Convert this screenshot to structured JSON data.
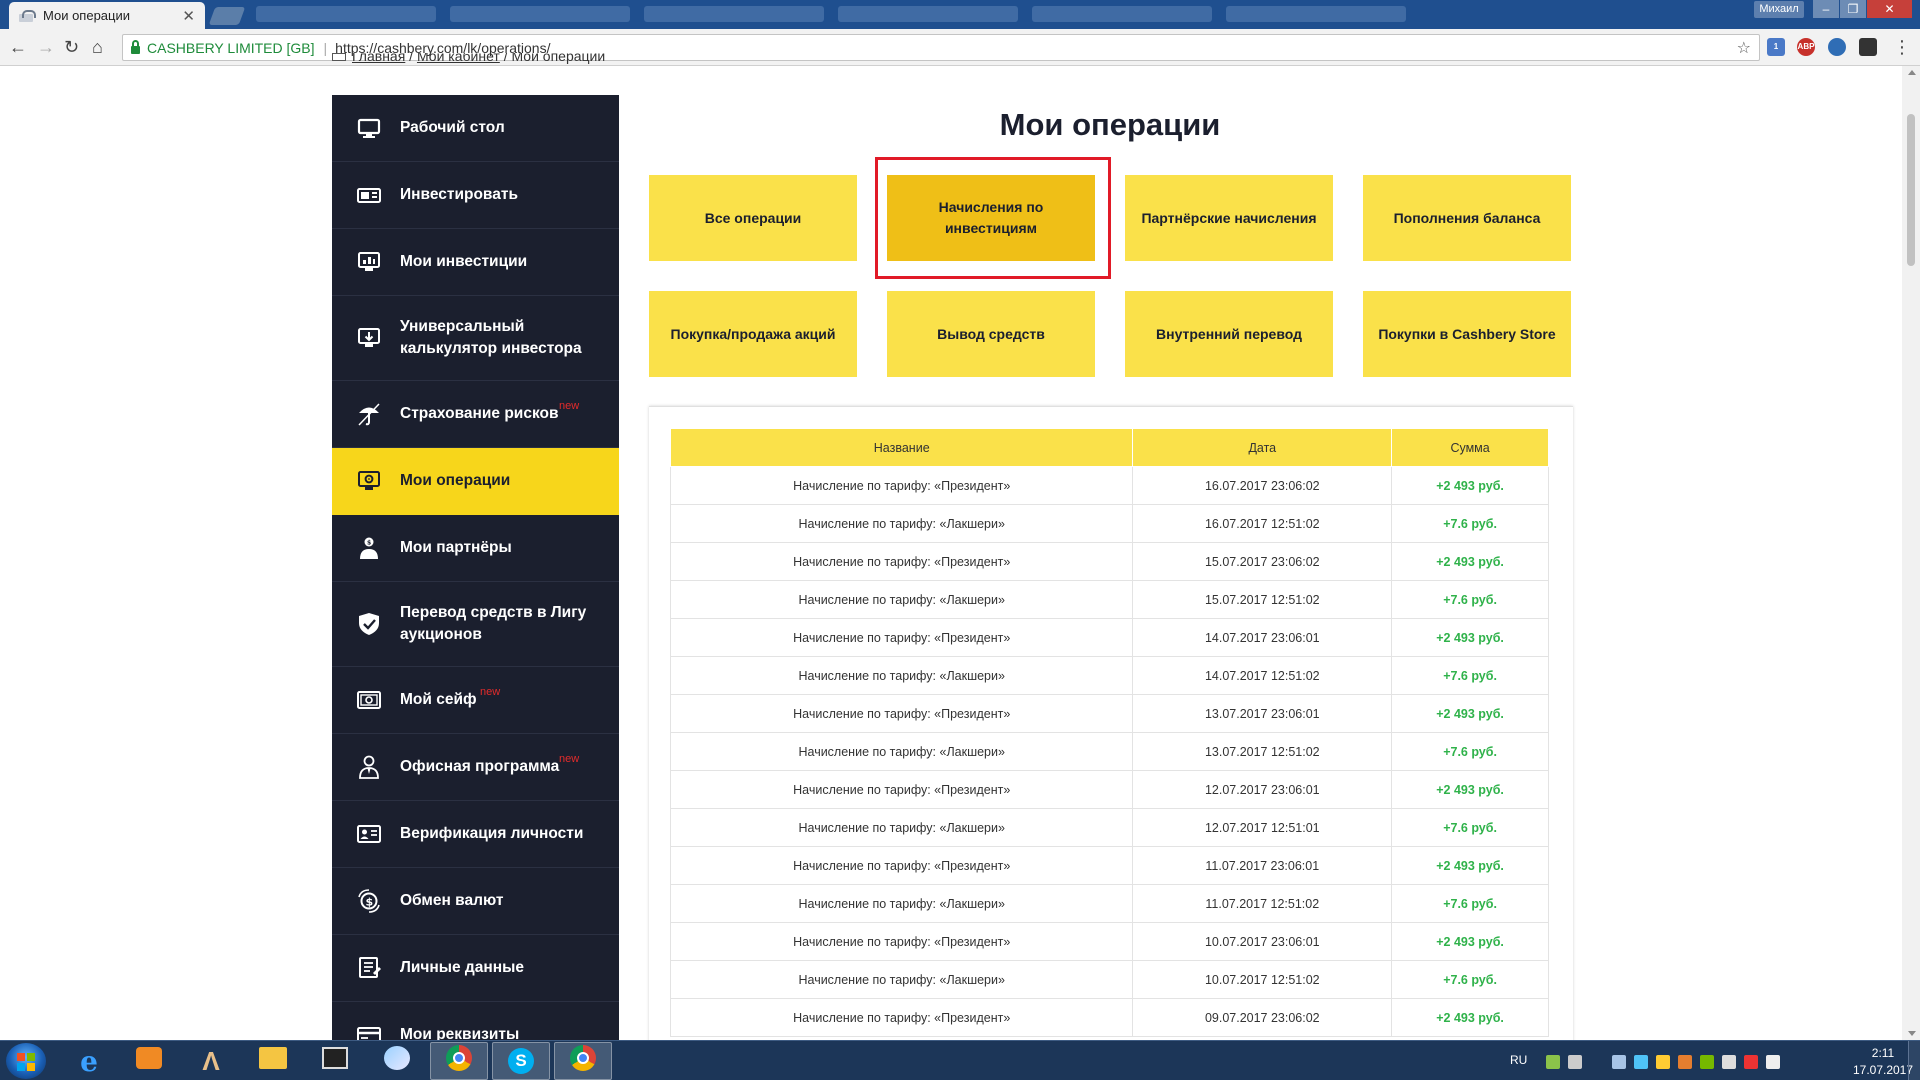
{
  "browser": {
    "tab_title": "Мои операции",
    "tab_close": "✕",
    "user_name": "Михаил",
    "win_buttons": [
      "–",
      "❐",
      "✕"
    ],
    "ev_label": "CASHBERY LIMITED [GB]",
    "url": "https://cashbery.com/lk/operations/",
    "ext_badges": [
      "1",
      "ABP"
    ]
  },
  "breadcrumb": {
    "items": [
      "Главная",
      "Мой кабинет"
    ],
    "separator": " / ",
    "current": "Мои операции"
  },
  "sidebar": {
    "items": [
      {
        "label": "Рабочий стол",
        "icon": "monitor-icon"
      },
      {
        "label": "Инвестировать",
        "icon": "money-card-icon"
      },
      {
        "label": "Мои инвестиции",
        "icon": "monitor-chart-icon"
      },
      {
        "label": "Универсальный калькулятор инвестора",
        "icon": "monitor-download-icon"
      },
      {
        "label": "Страхование рисков",
        "icon": "umbrella-icon",
        "badge": "new"
      },
      {
        "label": "Мои операции",
        "icon": "monitor-gear-icon",
        "active": true
      },
      {
        "label": "Мои партнёры",
        "icon": "partners-icon"
      },
      {
        "label": "Перевод средств в Лигу аукционов",
        "icon": "shield-check-icon"
      },
      {
        "label": "Мой сейф",
        "icon": "safe-icon",
        "badge": "new"
      },
      {
        "label": "Офисная программа",
        "icon": "office-worker-icon",
        "badge": "new"
      },
      {
        "label": "Верификация личности",
        "icon": "id-card-icon"
      },
      {
        "label": "Обмен валют",
        "icon": "currency-exchange-icon"
      },
      {
        "label": "Личные данные",
        "icon": "personal-data-icon"
      },
      {
        "label": "Мои реквизиты",
        "icon": "requisites-icon"
      }
    ]
  },
  "main": {
    "title": "Мои операции",
    "categories": [
      {
        "label": "Все операции"
      },
      {
        "label": "Начисления по инвестициям",
        "selected": true
      },
      {
        "label": "Партнёрские начисления"
      },
      {
        "label": "Пополнения баланса"
      },
      {
        "label": "Покупка/продажа акций"
      },
      {
        "label": "Вывод средств"
      },
      {
        "label": "Внутренний перевод"
      },
      {
        "label": "Покупки в Cashbery Store"
      }
    ],
    "table": {
      "headers": [
        "Название",
        "Дата",
        "Сумма"
      ],
      "rows": [
        [
          "Начисление по тарифу: «Президент»",
          "16.07.2017 23:06:02",
          "+2 493 руб."
        ],
        [
          "Начисление по тарифу: «Лакшери»",
          "16.07.2017 12:51:02",
          "+7.6 руб."
        ],
        [
          "Начисление по тарифу: «Президент»",
          "15.07.2017 23:06:02",
          "+2 493 руб."
        ],
        [
          "Начисление по тарифу: «Лакшери»",
          "15.07.2017 12:51:02",
          "+7.6 руб."
        ],
        [
          "Начисление по тарифу: «Президент»",
          "14.07.2017 23:06:01",
          "+2 493 руб."
        ],
        [
          "Начисление по тарифу: «Лакшери»",
          "14.07.2017 12:51:02",
          "+7.6 руб."
        ],
        [
          "Начисление по тарифу: «Президент»",
          "13.07.2017 23:06:01",
          "+2 493 руб."
        ],
        [
          "Начисление по тарифу: «Лакшери»",
          "13.07.2017 12:51:02",
          "+7.6 руб."
        ],
        [
          "Начисление по тарифу: «Президент»",
          "12.07.2017 23:06:01",
          "+2 493 руб."
        ],
        [
          "Начисление по тарифу: «Лакшери»",
          "12.07.2017 12:51:01",
          "+7.6 руб."
        ],
        [
          "Начисление по тарифу: «Президент»",
          "11.07.2017 23:06:01",
          "+2 493 руб."
        ],
        [
          "Начисление по тарифу: «Лакшери»",
          "11.07.2017 12:51:02",
          "+7.6 руб."
        ],
        [
          "Начисление по тарифу: «Президент»",
          "10.07.2017 23:06:01",
          "+2 493 руб."
        ],
        [
          "Начисление по тарифу: «Лакшери»",
          "10.07.2017 12:51:02",
          "+7.6 руб."
        ],
        [
          "Начисление по тарифу: «Президент»",
          "09.07.2017 23:06:02",
          "+2 493 руб."
        ]
      ]
    }
  },
  "taskbar": {
    "apps": [
      "internet-explorer-icon",
      "media-player-icon",
      "aimp-icon",
      "file-explorer-icon",
      "video-editor-icon",
      "browser-fish-icon",
      "chrome-icon",
      "skype-icon",
      "chrome-icon"
    ],
    "language": "RU",
    "time": "2:11",
    "date": "17.07.2017"
  },
  "colors": {
    "accent_yellow": "#fae14a",
    "selected_yellow": "#efbf17",
    "sidebar_bg": "#1b1f2e",
    "active_item": "#f7d61b",
    "amount_green": "#2fb24a",
    "highlight_red": "#e11a27",
    "new_badge": "#e32b2b"
  }
}
